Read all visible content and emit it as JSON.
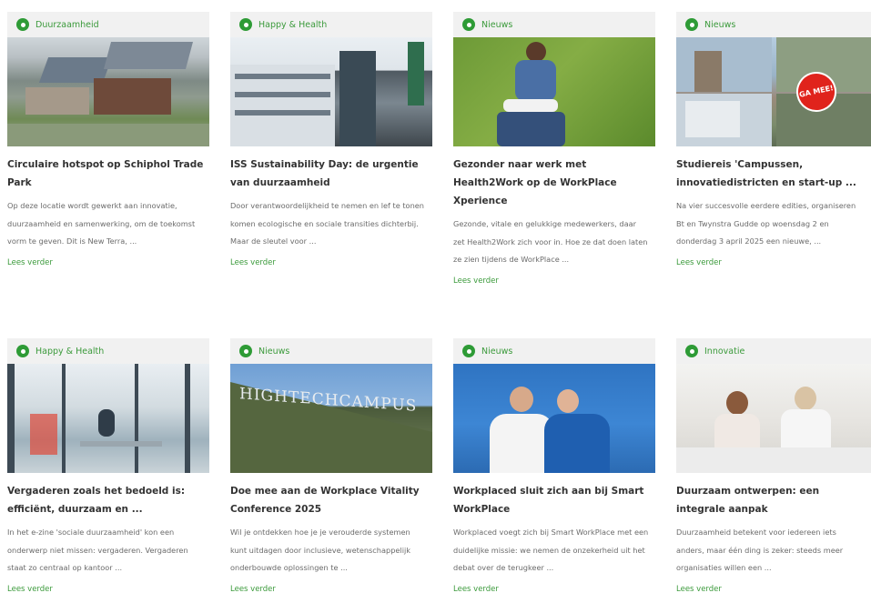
{
  "colors": {
    "accent": "#3b9a3b",
    "category_icon": "#2e9b36",
    "header_bg": "#f1f1f1",
    "title": "#333333",
    "excerpt": "#6b6b6b"
  },
  "cards": [
    {
      "category": "Duurzaamheid",
      "title": "Circulaire hotspot op Schiphol Trade Park",
      "excerpt": "Op deze locatie wordt gewerkt aan innovatie, duurzaamheid en samenwerking, om de toekomst vorm te geven. Dit is New Terra, ...",
      "more": "Lees verder",
      "image": "aerial-building-with-solar-panels"
    },
    {
      "category": "Happy & Health",
      "title": "ISS Sustainability Day: de urgentie van duurzaamheid",
      "excerpt": "Door verantwoordelijkheid te nemen en lef te tonen komen ecologische en sociale transities dichterbij. Maar de sleutel voor ...",
      "more": "Lees verder",
      "image": "iss-office-building"
    },
    {
      "category": "Nieuws",
      "title": "Gezonder naar werk met Health2Work op de WorkPlace Xperience",
      "excerpt": "Gezonde, vitale en gelukkige medewerkers, daar zet Health2Work zich voor in. Hoe ze dat doen laten ze zien tijdens de WorkPlace ...",
      "more": "Lees verder",
      "image": "woman-on-grass"
    },
    {
      "category": "Nieuws",
      "title": "Studiereis 'Campussen, innovatiedistricten en start-up ...",
      "excerpt": "Na vier succesvolle eerdere edities, organiseren Bt en Twynstra Gudde op woensdag 2 en donderdag 3 april 2025 een nieuwe, ...",
      "more": "Lees verder",
      "image": "campus-collage",
      "badge": "GA MEE!"
    },
    {
      "category": "Happy & Health",
      "title": "Vergaderen zoals het bedoeld is: efficiënt, duurzaam en ...",
      "excerpt": "In het e-zine 'sociale duurzaamheid' kon een onderwerp niet missen: vergaderen. Vergaderen staat zo centraal op kantoor ...",
      "more": "Lees verder",
      "image": "office-interior"
    },
    {
      "category": "Nieuws",
      "title": "Doe mee aan de Workplace Vitality Conference 2025",
      "excerpt": "Wil je ontdekken hoe je je verouderde systemen kunt uitdagen door inclusieve, wetenschappelijk onderbouwde oplossingen te ...",
      "more": "Lees verder",
      "image": "high-tech-campus-sign",
      "sign": "HIGHTECHCAMPUS"
    },
    {
      "category": "Nieuws",
      "title": "Workplaced sluit zich aan bij Smart WorkPlace",
      "excerpt": "Workplaced voegt zich bij Smart WorkPlace met een duidelijke missie: we nemen de onzekerheid uit het debat over de terugkeer ...",
      "more": "Lees verder",
      "image": "two-men-blue-wall"
    },
    {
      "category": "Innovatie",
      "title": "Duurzaam ontwerpen: een integrale aanpak",
      "excerpt": "Duurzaamheid betekent voor iedereen iets anders, maar één ding is zeker: steeds meer organisaties willen een ...",
      "more": "Lees verder",
      "image": "office-meeting"
    }
  ]
}
